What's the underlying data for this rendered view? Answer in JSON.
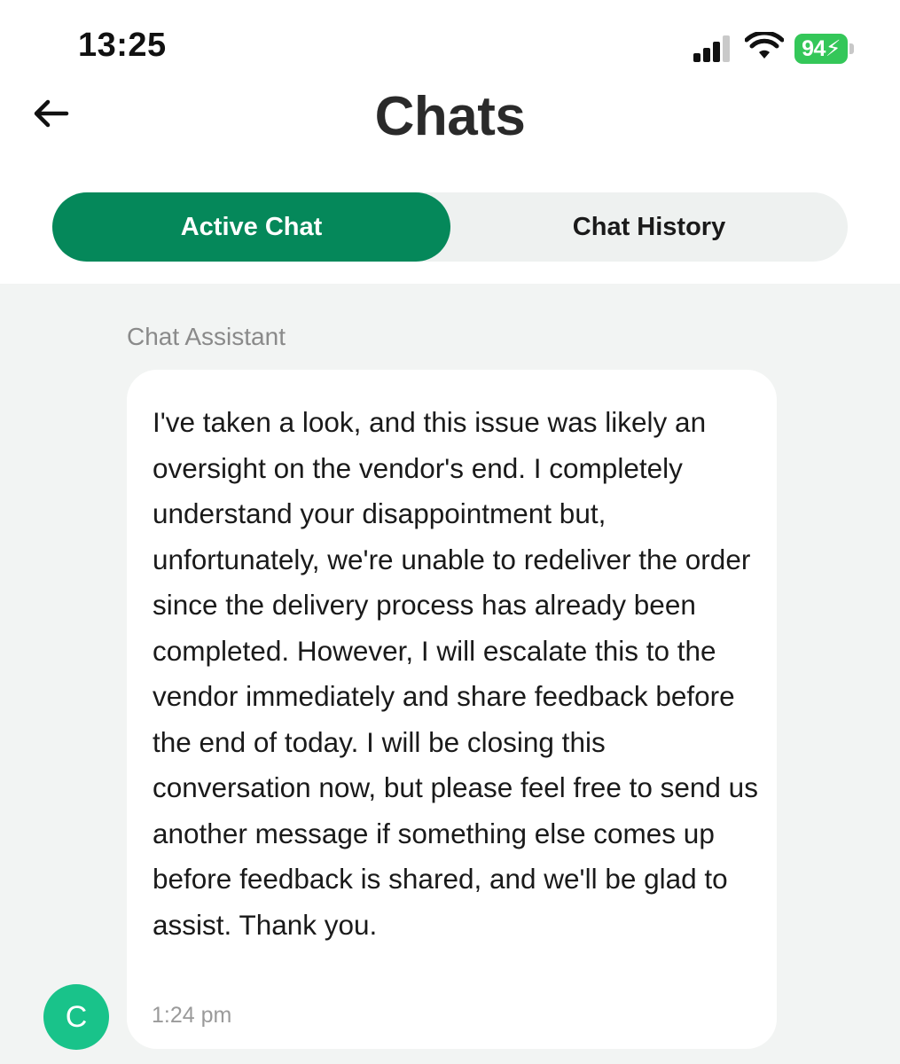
{
  "status_bar": {
    "time": "13:25",
    "battery_percent": "94",
    "icons": [
      "signal-icon",
      "wifi-icon",
      "battery-charging-icon"
    ],
    "battery_color": "#34c759"
  },
  "header": {
    "back_icon": "arrow-left-icon",
    "title": "Chats"
  },
  "tabs": [
    {
      "label": "Active Chat",
      "active": true
    },
    {
      "label": "Chat History",
      "active": false
    }
  ],
  "colors": {
    "accent": "#05885a",
    "avatar": "#19c38a",
    "chat_background": "#f2f4f3"
  },
  "messages": [
    {
      "sender": "Chat Assistant",
      "avatar_initial": "C",
      "text": "I've taken a look, and this issue was likely an oversight on the vendor's end. I completely understand your disappointment but, unfortunately, we're unable to redeliver the order since the delivery process has already been completed. However, I will escalate this to the vendor immediately and share feedback before the end of today. I will be closing this conversation now, but please feel free to send us another message if something else comes up before feedback is shared, and we'll be glad to assist. Thank you.",
      "time": "1:24 pm"
    }
  ]
}
